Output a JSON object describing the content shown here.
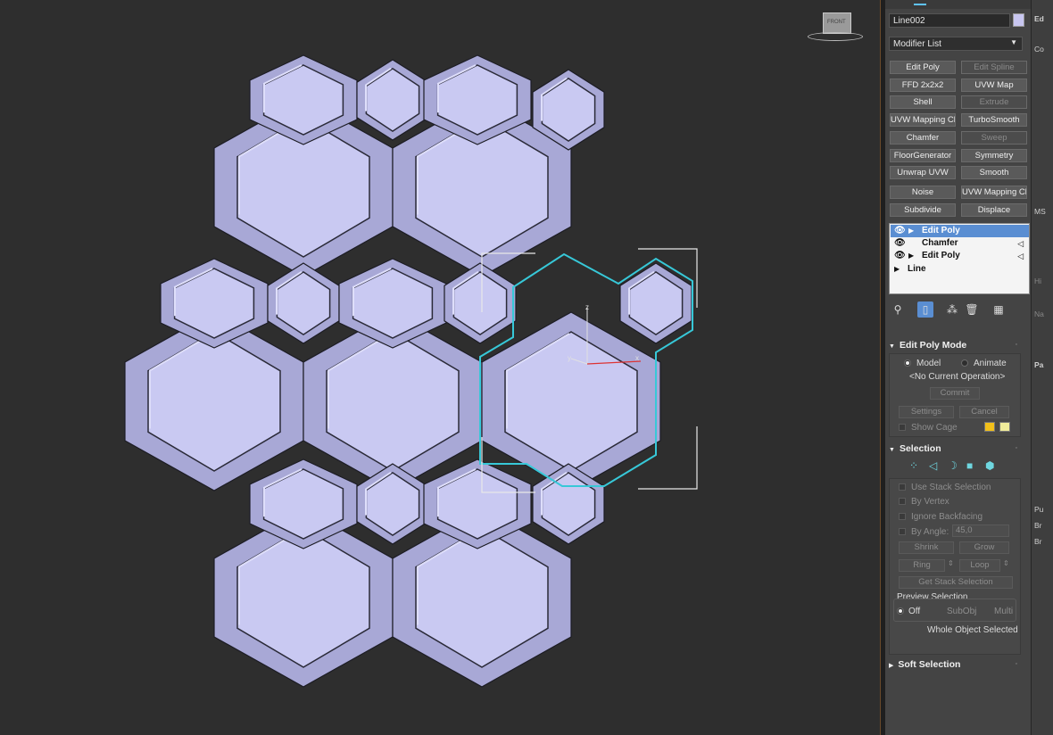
{
  "viewport": {
    "viewcube_label": "FRONT",
    "gizmo_axes": {
      "z": "z",
      "y": "y",
      "x": "x"
    }
  },
  "panel": {
    "object_name": "Line002",
    "modifier_list": "Modifier List",
    "modifier_buttons": [
      "Edit Poly",
      "Edit Spline",
      "FFD 2x2x2",
      "UVW Map",
      "Shell",
      "Extrude",
      "UVW Mapping Clea",
      "TurboSmooth",
      "Chamfer",
      "Sweep",
      "FloorGenerator",
      "Symmetry",
      "Unwrap UVW",
      "Smooth",
      "Noise",
      "UVW Mapping Clea",
      "Subdivide",
      "Displace"
    ],
    "stack": [
      {
        "label": "Edit Poly"
      },
      {
        "label": "Chamfer"
      },
      {
        "label": "Edit Poly"
      },
      {
        "label": "Line"
      }
    ],
    "edit_poly_mode": {
      "title": "Edit Poly Mode",
      "model": "Model",
      "animate": "Animate",
      "current_op": "<No Current Operation>",
      "commit": "Commit",
      "settings": "Settings",
      "cancel": "Cancel",
      "show_cage": "Show Cage",
      "cage_color_1": "#f2c01a",
      "cage_color_2": "#f0ec9a"
    },
    "selection": {
      "title": "Selection",
      "use_stack": "Use Stack Selection",
      "by_vertex": "By Vertex",
      "ignore_backfacing": "Ignore Backfacing",
      "by_angle": "By Angle:",
      "angle_value": "45,0",
      "shrink": "Shrink",
      "grow": "Grow",
      "ring": "Ring",
      "loop": "Loop",
      "get_stack_selection": "Get Stack Selection",
      "preview_selection": "Preview Selection",
      "off": "Off",
      "subobj": "SubObj",
      "multi": "Multi",
      "whole_object": "Whole Object Selected"
    },
    "soft_selection": {
      "title": "Soft Selection"
    }
  },
  "far_panel": {
    "labels": [
      "Ed",
      "Co",
      "MS",
      "Hi",
      "Na",
      "Pa",
      "Pu",
      "Br",
      "Br"
    ]
  },
  "colors": {
    "tile_face": "#c9c9f2",
    "tile_light": "#dedefa",
    "tile_shade": "#a8a8d6",
    "selection_outline": "#37c8d8",
    "stack_highlight": "#5a8ed2"
  }
}
